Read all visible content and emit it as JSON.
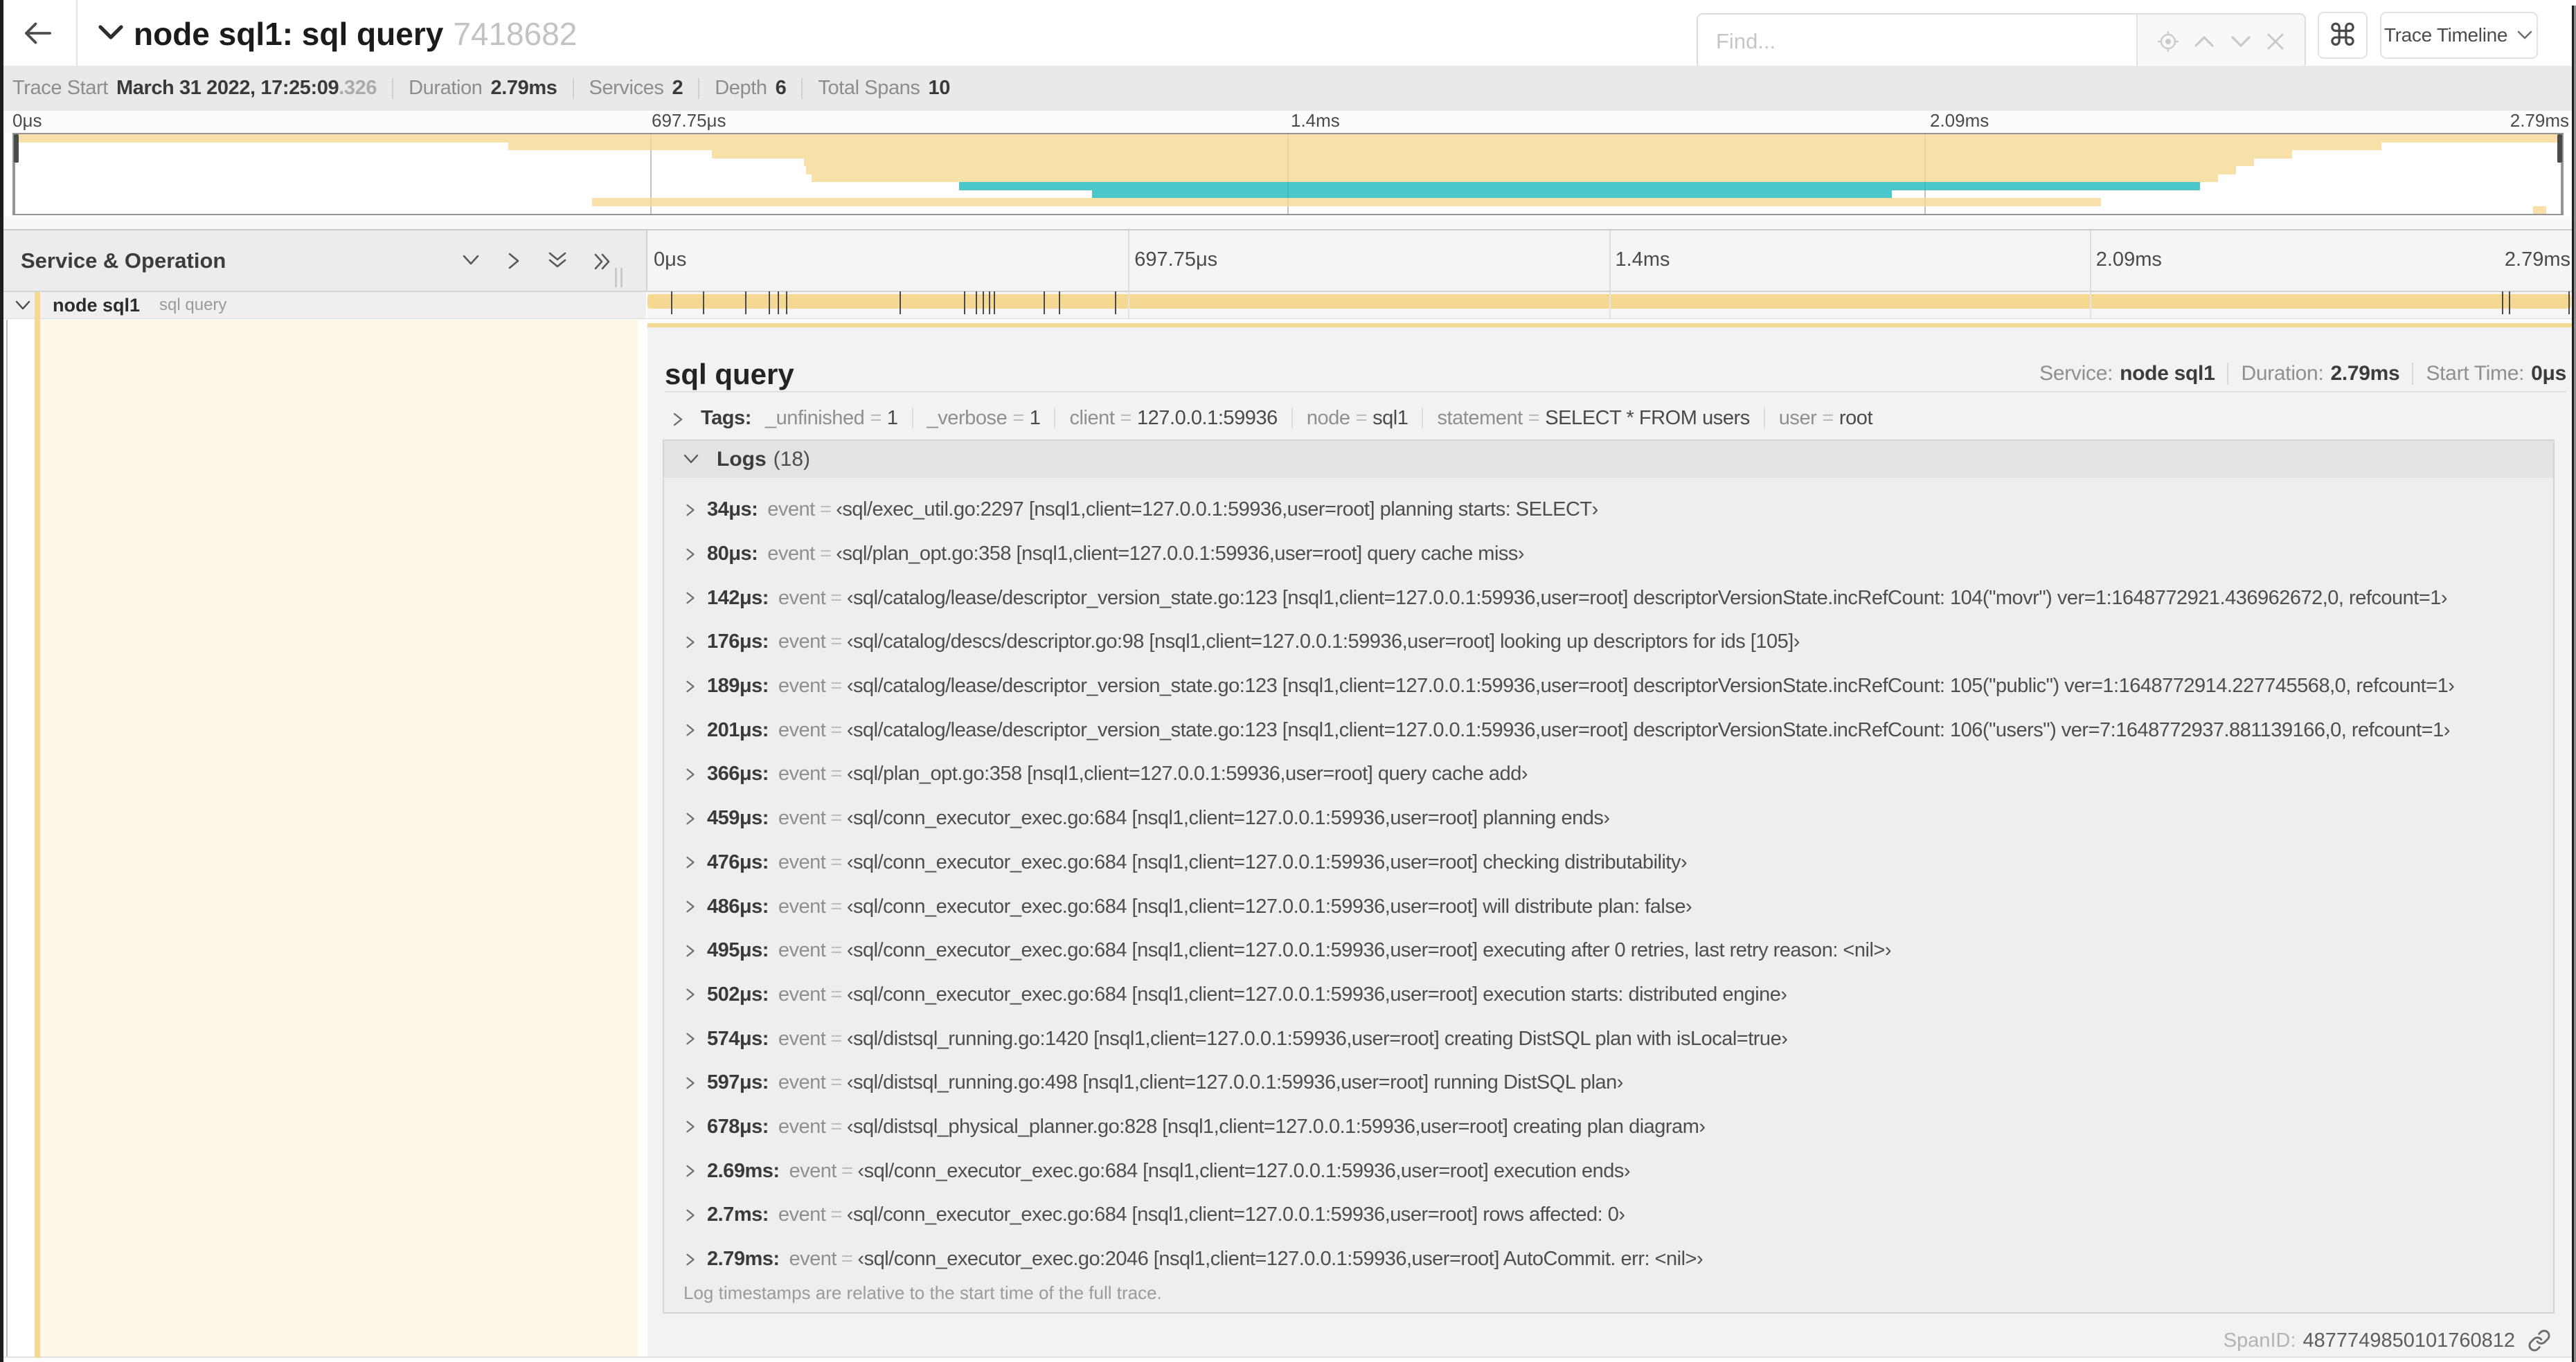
{
  "header": {
    "title": "node sql1: sql query",
    "trace_id_short": "7418682",
    "find_placeholder": "Find...",
    "keyboard_hint": "⌘",
    "view_select_label": "Trace Timeline"
  },
  "trace_info": {
    "trace_start_label": "Trace Start",
    "trace_start_value": "March 31 2022, 17:25:09",
    "trace_start_fraction": ".326",
    "duration_label": "Duration",
    "duration_value": "2.79ms",
    "services_label": "Services",
    "services_value": "2",
    "depth_label": "Depth",
    "depth_value": "6",
    "total_spans_label": "Total Spans",
    "total_spans_value": "10"
  },
  "colors": {
    "span_tan": "#f5d992",
    "span_teal": "#1fb9bc",
    "minimap_alpha": 0.8
  },
  "minimap": {
    "tick_labels": [
      "0μs",
      "697.75μs",
      "1.4ms",
      "2.09ms",
      "2.79ms"
    ],
    "spans": [
      {
        "start": 0.0,
        "end": 1.0,
        "color": "tan"
      },
      {
        "start": 0.194,
        "end": 0.929,
        "color": "tan"
      },
      {
        "start": 0.274,
        "end": 0.894,
        "color": "tan"
      },
      {
        "start": 0.31,
        "end": 0.879,
        "color": "tan"
      },
      {
        "start": 0.311,
        "end": 0.872,
        "color": "tan"
      },
      {
        "start": 0.313,
        "end": 0.865,
        "color": "tan"
      },
      {
        "start": 0.371,
        "end": 0.858,
        "color": "teal"
      },
      {
        "start": 0.423,
        "end": 0.737,
        "color": "teal"
      },
      {
        "start": 0.227,
        "end": 0.819,
        "color": "tan"
      },
      {
        "start": 0.9887,
        "end": 0.9938,
        "color": "tan"
      }
    ]
  },
  "timeline": {
    "header_label": "Service & Operation",
    "tick_labels": [
      "0μs",
      "697.75μs",
      "1.4ms",
      "2.09ms",
      "2.79ms"
    ],
    "row": {
      "service": "node sql1",
      "operation": "sql query",
      "duration_us": 2790,
      "log_times_us": [
        34,
        80,
        142,
        176,
        189,
        201,
        366,
        459,
        476,
        486,
        495,
        502,
        574,
        597,
        678,
        2690,
        2700,
        2790
      ]
    }
  },
  "detail": {
    "operation": "sql query",
    "service_label": "Service:",
    "service_value": "node sql1",
    "duration_label": "Duration:",
    "duration_value": "2.79ms",
    "start_time_label": "Start Time:",
    "start_time_value": "0μs",
    "tags_label": "Tags:",
    "tags": [
      {
        "key": "_unfinished",
        "value": "1"
      },
      {
        "key": "_verbose",
        "value": "1"
      },
      {
        "key": "client",
        "value": "127.0.0.1:59936"
      },
      {
        "key": "node",
        "value": "sql1"
      },
      {
        "key": "statement",
        "value": "SELECT * FROM users"
      },
      {
        "key": "user",
        "value": "root"
      }
    ],
    "logs_label": "Logs",
    "logs_count": "(18)",
    "logs": [
      {
        "time": "34μs:",
        "key": "event",
        "value": "‹sql/exec_util.go:2297 [nsql1,client=127.0.0.1:59936,user=root] planning starts: SELECT›"
      },
      {
        "time": "80μs:",
        "key": "event",
        "value": "‹sql/plan_opt.go:358 [nsql1,client=127.0.0.1:59936,user=root] query cache miss›"
      },
      {
        "time": "142μs:",
        "key": "event",
        "value": "‹sql/catalog/lease/descriptor_version_state.go:123 [nsql1,client=127.0.0.1:59936,user=root] descriptorVersionState.incRefCount: 104(\"movr\") ver=1:1648772921.436962672,0, refcount=1›"
      },
      {
        "time": "176μs:",
        "key": "event",
        "value": "‹sql/catalog/descs/descriptor.go:98 [nsql1,client=127.0.0.1:59936,user=root] looking up descriptors for ids [105]›"
      },
      {
        "time": "189μs:",
        "key": "event",
        "value": "‹sql/catalog/lease/descriptor_version_state.go:123 [nsql1,client=127.0.0.1:59936,user=root] descriptorVersionState.incRefCount: 105(\"public\") ver=1:1648772914.227745568,0, refcount=1›"
      },
      {
        "time": "201μs:",
        "key": "event",
        "value": "‹sql/catalog/lease/descriptor_version_state.go:123 [nsql1,client=127.0.0.1:59936,user=root] descriptorVersionState.incRefCount: 106(\"users\") ver=7:1648772937.881139166,0, refcount=1›"
      },
      {
        "time": "366μs:",
        "key": "event",
        "value": "‹sql/plan_opt.go:358 [nsql1,client=127.0.0.1:59936,user=root] query cache add›"
      },
      {
        "time": "459μs:",
        "key": "event",
        "value": "‹sql/conn_executor_exec.go:684 [nsql1,client=127.0.0.1:59936,user=root] planning ends›"
      },
      {
        "time": "476μs:",
        "key": "event",
        "value": "‹sql/conn_executor_exec.go:684 [nsql1,client=127.0.0.1:59936,user=root] checking distributability›"
      },
      {
        "time": "486μs:",
        "key": "event",
        "value": "‹sql/conn_executor_exec.go:684 [nsql1,client=127.0.0.1:59936,user=root] will distribute plan: false›"
      },
      {
        "time": "495μs:",
        "key": "event",
        "value": "‹sql/conn_executor_exec.go:684 [nsql1,client=127.0.0.1:59936,user=root] executing after 0 retries, last retry reason: <nil>›"
      },
      {
        "time": "502μs:",
        "key": "event",
        "value": "‹sql/conn_executor_exec.go:684 [nsql1,client=127.0.0.1:59936,user=root] execution starts: distributed engine›"
      },
      {
        "time": "574μs:",
        "key": "event",
        "value": "‹sql/distsql_running.go:1420 [nsql1,client=127.0.0.1:59936,user=root] creating DistSQL plan with isLocal=true›"
      },
      {
        "time": "597μs:",
        "key": "event",
        "value": "‹sql/distsql_running.go:498 [nsql1,client=127.0.0.1:59936,user=root] running DistSQL plan›"
      },
      {
        "time": "678μs:",
        "key": "event",
        "value": "‹sql/distsql_physical_planner.go:828 [nsql1,client=127.0.0.1:59936,user=root] creating plan diagram›"
      },
      {
        "time": "2.69ms:",
        "key": "event",
        "value": "‹sql/conn_executor_exec.go:684 [nsql1,client=127.0.0.1:59936,user=root] execution ends›"
      },
      {
        "time": "2.7ms:",
        "key": "event",
        "value": "‹sql/conn_executor_exec.go:684 [nsql1,client=127.0.0.1:59936,user=root] rows affected: 0›"
      },
      {
        "time": "2.79ms:",
        "key": "event",
        "value": "‹sql/conn_executor_exec.go:2046 [nsql1,client=127.0.0.1:59936,user=root] AutoCommit. err: <nil>›"
      }
    ],
    "logs_note": "Log timestamps are relative to the start time of the full trace.",
    "span_id_label": "SpanID:",
    "span_id_value": "4877749850101760812"
  }
}
